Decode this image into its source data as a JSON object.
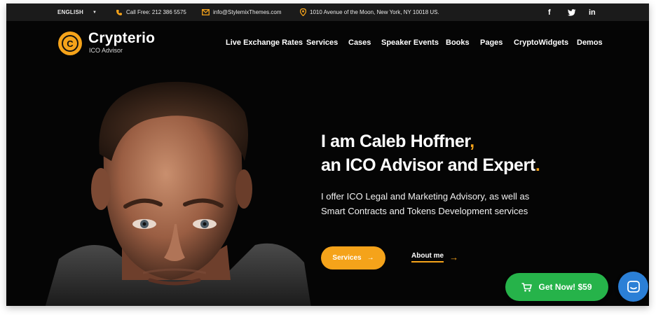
{
  "topbar": {
    "language": "ENGLISH",
    "phone": "Call Free: 212 386 5575",
    "email": "info@StylemixThemes.com",
    "address": "1010 Avenue of the Moon, New York, NY 10018 US.",
    "social": {
      "facebook": "f",
      "twitter": "twitter-icon",
      "linkedin": "in"
    }
  },
  "brand": {
    "name": "Crypterio",
    "tagline": "ICO Advisor"
  },
  "nav": [
    "Live Exchange Rates",
    "Services",
    "Cases",
    "Speaker Events",
    "Books",
    "Pages",
    "CryptoWidgets",
    "Demos"
  ],
  "hero": {
    "title_line1": "I am Caleb Hoffner",
    "title_line1_punct": ",",
    "title_line2": "an ICO Advisor and Expert",
    "title_line2_punct": ".",
    "desc_line1": "I offer ICO Legal and Marketing Advisory, as well as",
    "desc_line2": "Smart Contracts and Tokens Development services",
    "primary_button": "Services",
    "secondary_link": "About me"
  },
  "cta": {
    "label": "Get Now! $59"
  },
  "colors": {
    "accent": "#f5a31a",
    "cta": "#26b34a",
    "chat": "#2b7fd6",
    "background": "#050505"
  },
  "icons": [
    "caret-down-icon",
    "phone-icon",
    "mail-icon",
    "location-pin-icon",
    "facebook-icon",
    "twitter-icon",
    "linkedin-icon",
    "arrow-right-icon",
    "cart-icon",
    "chat-icon"
  ]
}
